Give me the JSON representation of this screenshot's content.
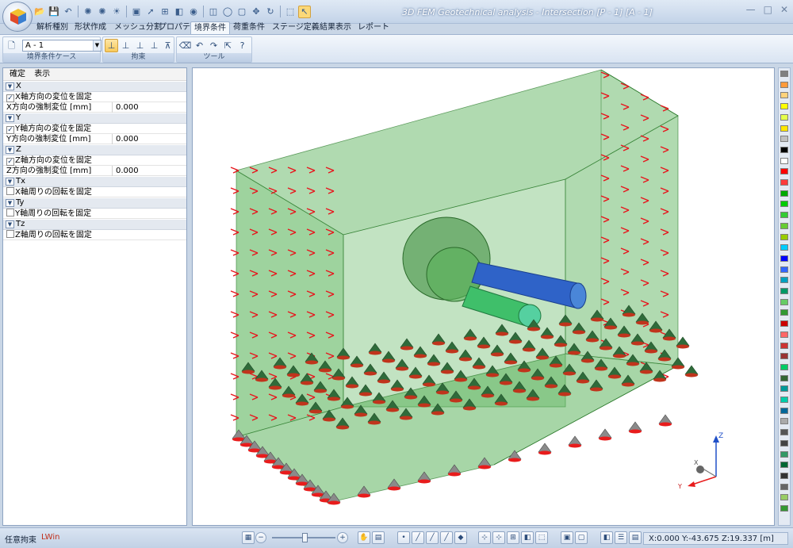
{
  "app": {
    "title": "3D FEM Geotechnical analysis - Intersection [P - 1] [A - 1]",
    "window_controls": [
      "—",
      "□",
      "✕"
    ]
  },
  "quick_access": [
    "open-icon",
    "save-icon",
    "undo-icon",
    "light-icon",
    "light2-icon",
    "sun-icon",
    "view-icon",
    "arrow-icon",
    "mesh-icon",
    "render-icon",
    "camera-icon",
    "clip-icon",
    "zoom-icon",
    "fit-icon",
    "pan-icon",
    "rotate-icon",
    "select-icon",
    "cursor-icon"
  ],
  "tabs": [
    {
      "label": "解析種別",
      "active": false
    },
    {
      "label": "形状作成",
      "active": false
    },
    {
      "label": "メッシュ分割",
      "active": false
    },
    {
      "label": "プロパティ",
      "active": false
    },
    {
      "label": "境界条件",
      "active": true
    },
    {
      "label": "荷重条件",
      "active": false
    },
    {
      "label": "ステージ定義",
      "active": false
    },
    {
      "label": "結果表示",
      "active": false
    },
    {
      "label": "レポート",
      "active": false
    }
  ],
  "ribbon": {
    "case_group": {
      "title": "境界条件ケース",
      "selected": "A - 1"
    },
    "constraint_group": {
      "title": "拘束"
    },
    "tool_group": {
      "title": "ツール"
    }
  },
  "left_panel": {
    "menu": [
      "確定",
      "表示"
    ],
    "sections": [
      {
        "header": "X",
        "fix_label": "X軸方向の変位を固定",
        "fixed": true,
        "forced_label": "X方向の強制変位 [mm]",
        "forced_value": "0.000"
      },
      {
        "header": "Y",
        "fix_label": "Y軸方向の変位を固定",
        "fixed": true,
        "forced_label": "Y方向の強制変位 [mm]",
        "forced_value": "0.000"
      },
      {
        "header": "Z",
        "fix_label": "Z軸方向の変位を固定",
        "fixed": true,
        "forced_label": "Z方向の強制変位 [mm]",
        "forced_value": "0.000"
      },
      {
        "header": "Tx",
        "fix_label": "X軸周りの回転を固定",
        "fixed": false
      },
      {
        "header": "Ty",
        "fix_label": "Y軸周りの回転を固定",
        "fixed": false
      },
      {
        "header": "Tz",
        "fix_label": "Z軸周りの回転を固定",
        "fixed": false
      }
    ]
  },
  "viewport": {
    "axis_labels": {
      "z": "Z",
      "x": "X",
      "y": "Y"
    },
    "colors": {
      "volume": "#4fae4f",
      "arrow": "#e8141c",
      "pipe_blue": "#2f63c8",
      "pipe_green": "#3fbf6a",
      "support": "#2f6b3a"
    }
  },
  "palette": [
    "#808080",
    "#ff9a3a",
    "#ffd27a",
    "#ffff00",
    "#e6ff4a",
    "#ffe600",
    "#c0c0c0",
    "#000000",
    "#ffffff",
    "#ff0000",
    "#ff3b3b",
    "#00aa00",
    "#00cc00",
    "#33cc33",
    "#66cc33",
    "#99cc00",
    "#00ccff",
    "#0000ff",
    "#3366ff",
    "#00a0c0",
    "#009966",
    "#66cc66",
    "#339933",
    "#cc0000",
    "#ff6666",
    "#cc3333",
    "#993333",
    "#00cc66",
    "#336633",
    "#009999",
    "#00ccaa",
    "#006699",
    "#aaaaaa",
    "#555555",
    "#444444",
    "#339966",
    "#006633",
    "#333333",
    "#666666",
    "#99cc66",
    "#339933"
  ],
  "status": {
    "mode": "任意拘束",
    "layer": "LWin",
    "coords": "X:0.000 Y:-43.675 Z:19.337 [m]"
  }
}
